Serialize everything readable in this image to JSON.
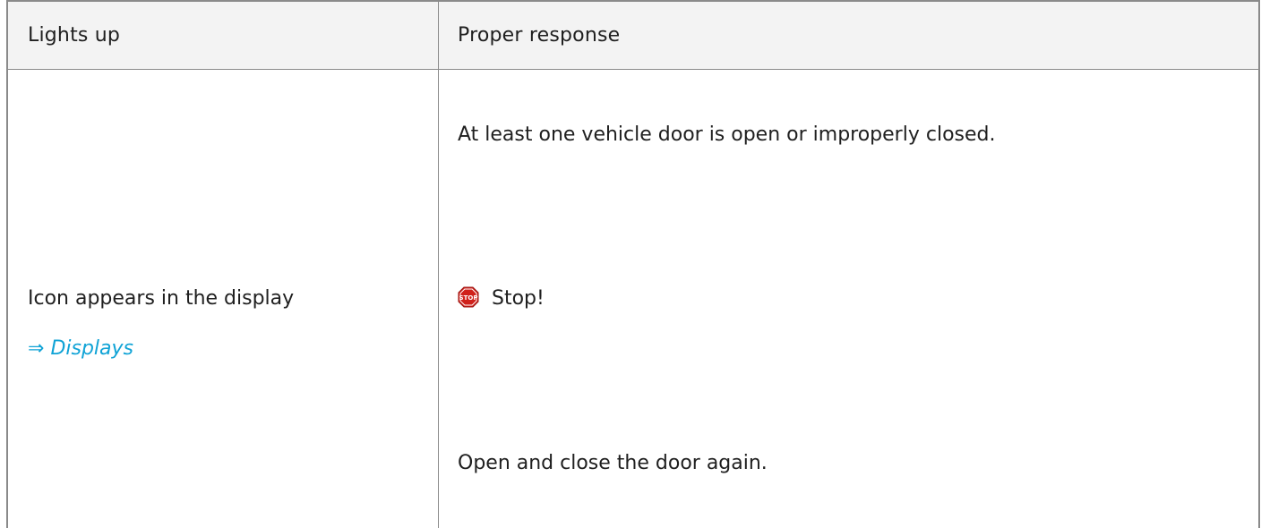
{
  "table": {
    "headers": {
      "col1": "Lights up",
      "col2": "Proper response"
    },
    "row": {
      "indicator": "Icon appears in the display",
      "link_arrow": "⇒",
      "link_label": "Displays",
      "response_line1": "At least one vehicle door is open or improperly closed.",
      "warning_label": "Stop!",
      "response_line2": "Open and close the door again."
    }
  },
  "colors": {
    "border": "#8a8a8a",
    "header_bg": "#f3f3f3",
    "link": "#10a3d6",
    "stop_red": "#d0211b"
  },
  "icons": {
    "warning": "stop-sign-icon"
  }
}
